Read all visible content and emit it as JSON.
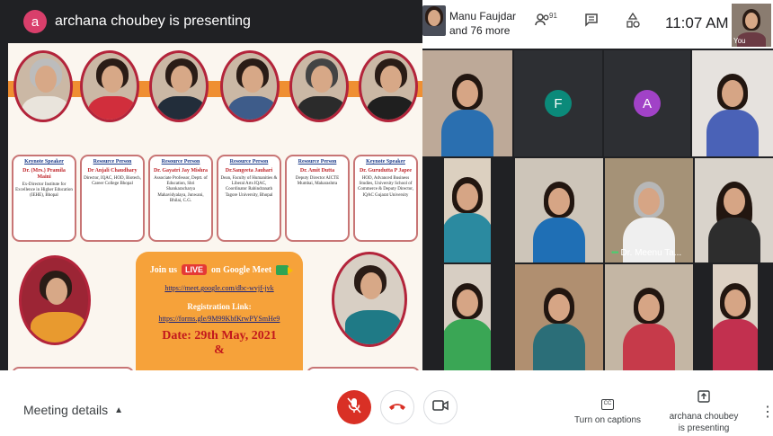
{
  "presentation": {
    "presenter_initial": "a",
    "presenter_title": "archana choubey is presenting",
    "cards": [
      {
        "role": "Keynote Speaker",
        "name": "Dr. (Mrs.) Pramila Maini",
        "desc": "Ex-Director Institute for Excellence in Higher Education (IEHE), Bhopal"
      },
      {
        "role": "Resource Person",
        "name": "Dr Anjali Chaudhary",
        "desc": "Director, IQAC, HOD, Biotech, Career College Bhopal"
      },
      {
        "role": "Resource Person",
        "name": "Dr. Gayatri Jay Mishra",
        "desc": "Associate Professor, Deptt. of Education, Shri Shankaracharya Mahavidyalaya, Junwani, Bhilai, C.G."
      },
      {
        "role": "Resource Person",
        "name": "Dr.Sangeeta Jauhari",
        "desc": "Dean, Faculty of Humanities & Liberal Arts IQAC, Coordinator Rabindranath Tagore University, Bhopal"
      },
      {
        "role": "Resource Person",
        "name": "Dr. Amit Dutta",
        "desc": "Deputy Director AICTE Mumbai, Maharashtra"
      },
      {
        "role": "Keynote Speaker",
        "name": "Dr. Gurudutta P Japee",
        "desc": "HOD, Advanced Business Studies, University School of Commerce & Deputy Director, IQAC Gujarat University"
      }
    ],
    "join": {
      "prefix": "Join us",
      "live": "LIVE",
      "suffix": "on Google Meet",
      "meet_link": "https://meet.google.com/dbc-wvjf-jvk",
      "reg_label": "Registration Link:",
      "reg_link": "https://forms.gle/9M99KbfKrwPYSmHe9",
      "date": "Date: 29th May, 2021",
      "amp": "&"
    }
  },
  "header": {
    "host_name_line1": "Manu Faujdar",
    "host_name_line2": "and 76 more",
    "people_count": "91",
    "time": "11:07 AM",
    "self_label": "You"
  },
  "tiles": {
    "letter_f": "F",
    "letter_a": "A",
    "name_tag": "Dr. Meenu Ta...",
    "letter_f_color": "#0b8a7a",
    "letter_a_color": "#a142c7"
  },
  "bottom_bar": {
    "meeting_details": "Meeting details",
    "captions_label": "Turn on captions",
    "captions_glyph": "CC",
    "presenting_line1": "archana choubey",
    "presenting_line2": "is presenting",
    "accent_red": "#d93025"
  }
}
